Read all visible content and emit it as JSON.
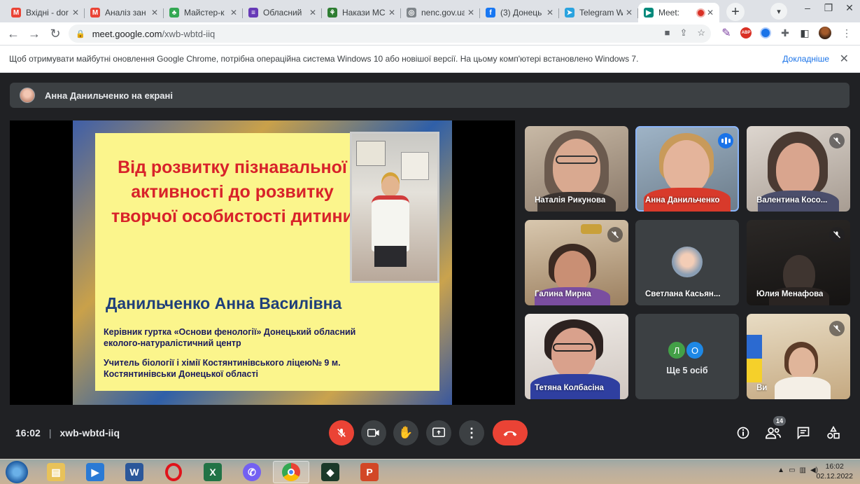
{
  "tabs": [
    {
      "title": "Вхідні - dor",
      "icon": "gmail-icon",
      "color": "#ea4335",
      "glyph": "M"
    },
    {
      "title": "Аналіз зан",
      "icon": "gmail-icon",
      "color": "#ea4335",
      "glyph": "M"
    },
    {
      "title": "Майстер-к",
      "icon": "leaf-icon",
      "color": "#34a853",
      "glyph": "♣"
    },
    {
      "title": "Обласний",
      "icon": "forms-icon",
      "color": "#673ab7",
      "glyph": "≡"
    },
    {
      "title": "Накази МС",
      "icon": "trident-icon",
      "color": "#2e7d32",
      "glyph": "⚘"
    },
    {
      "title": "nenc.gov.ua",
      "icon": "globe-icon",
      "color": "#80868b",
      "glyph": "◎"
    },
    {
      "title": "(3) Донець",
      "icon": "facebook-icon",
      "color": "#1877f2",
      "glyph": "f"
    },
    {
      "title": "Telegram W",
      "icon": "telegram-icon",
      "color": "#2aa3df",
      "glyph": "➤"
    },
    {
      "title": "Meet: ",
      "icon": "meet-icon",
      "color": "#00897b",
      "glyph": "▶",
      "active": true
    }
  ],
  "address": {
    "host": "meet.google.com",
    "path": "/xwb-wbtd-iiq"
  },
  "infobar": {
    "message": "Щоб отримувати майбутні оновлення Google Chrome, потрібна операційна система Windows 10 або новішої версії. На цьому комп'ютері встановлено Windows 7.",
    "more": "Докладніше"
  },
  "presenting": {
    "label": "Анна Данильченко на екрані"
  },
  "slide": {
    "title": "Від розвитку пізнавальної активності до розвитку творчої особистості дитини",
    "author": "Данильченко Анна Василівна",
    "desc1": "Керівник гуртка «Основи фенології» Донецький обласний еколого-натуралістичний центр",
    "desc2": "Учитель біології і хімії Костянтинівського ліцею№ 9 м. Костянтинівськи Донецької області"
  },
  "participants": [
    {
      "name": "Наталія Рикунова",
      "muted": false
    },
    {
      "name": "Анна Данильченко",
      "speaking": true
    },
    {
      "name": "Валентина Косо...",
      "muted": true
    },
    {
      "name": "Галина Мирна",
      "muted": true
    },
    {
      "name": "Светлана Касьян...",
      "muted": false
    },
    {
      "name": "Юлия Менафова",
      "muted": true
    },
    {
      "name": "Тетяна Колбасіна",
      "muted": false
    },
    {
      "name": "Ще 5 осіб",
      "initials": [
        "Л",
        "О"
      ]
    },
    {
      "name": "Ви",
      "muted": true
    }
  ],
  "meeting": {
    "time": "16:02",
    "separator": "|",
    "code": "xwb-wbtd-iiq",
    "people_count": "14"
  },
  "taskbar": {
    "time": "16:02",
    "date": "02.12.2022"
  }
}
